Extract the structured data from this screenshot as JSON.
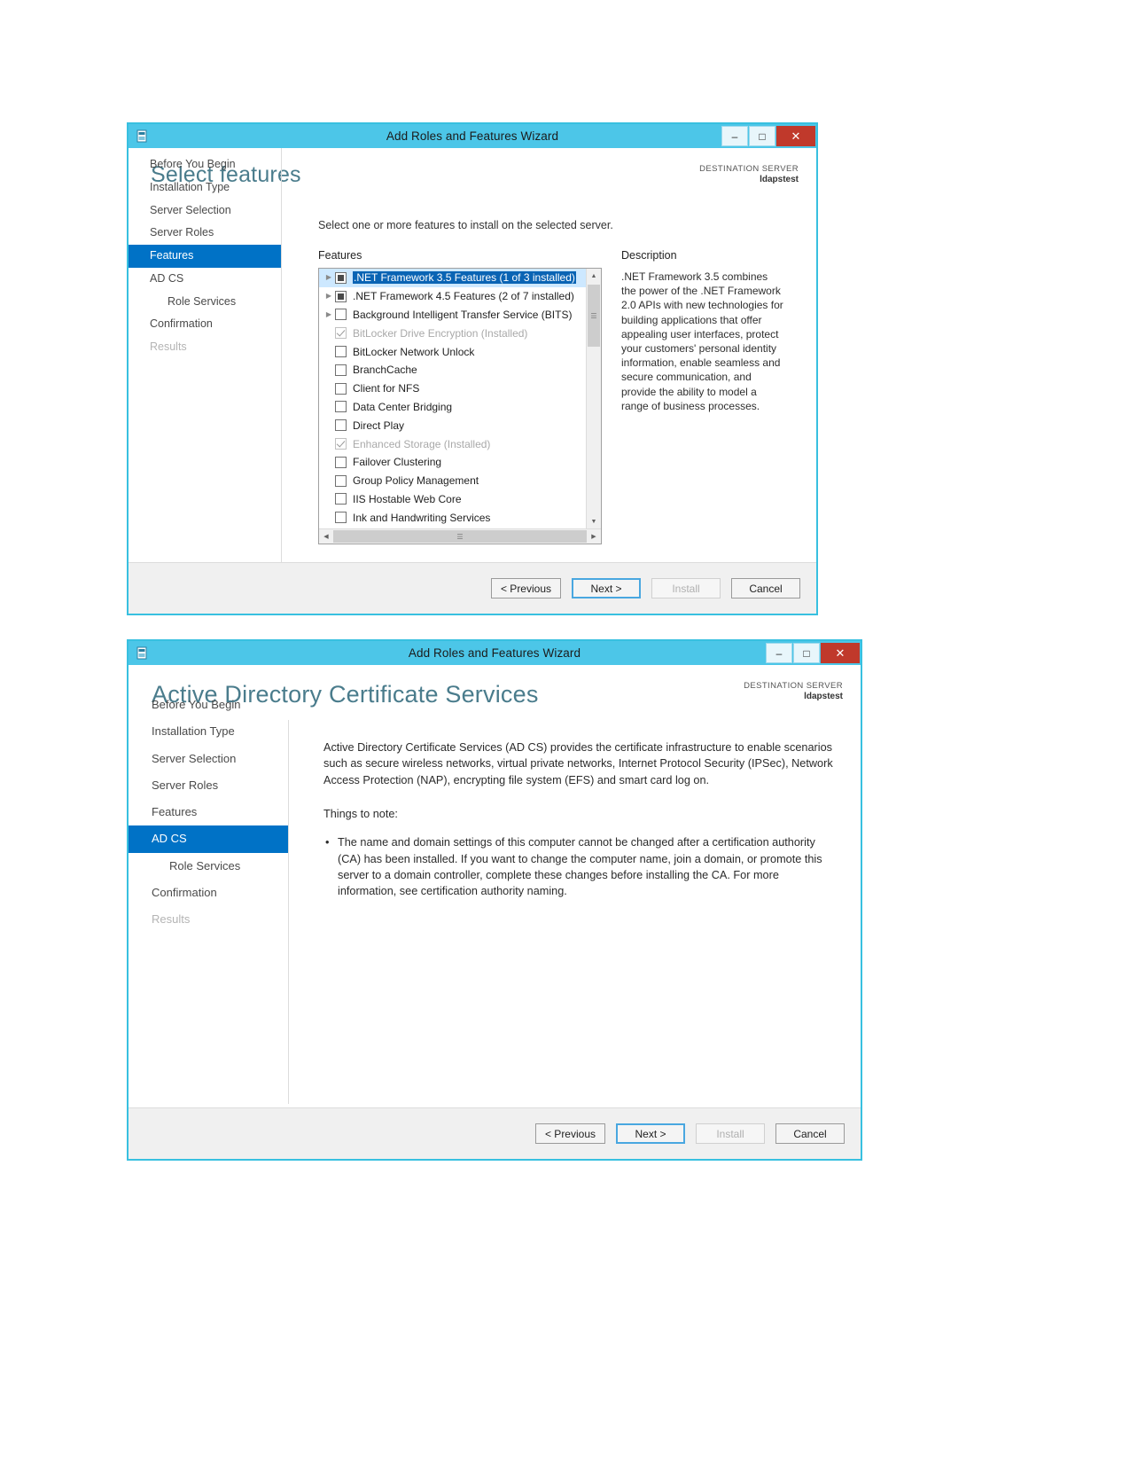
{
  "window_features": {
    "title": "Add Roles and Features Wizard",
    "icon": "server-manager-icon",
    "buttons": {
      "minimize": "–",
      "maximize": "□",
      "close": "✕"
    },
    "page_title": "Select features",
    "destination": {
      "label": "DESTINATION SERVER",
      "value": "ldapstest"
    },
    "nav": [
      {
        "label": "Before You Begin",
        "state": "normal"
      },
      {
        "label": "Installation Type",
        "state": "normal"
      },
      {
        "label": "Server Selection",
        "state": "normal"
      },
      {
        "label": "Server Roles",
        "state": "normal"
      },
      {
        "label": "Features",
        "state": "selected"
      },
      {
        "label": "AD CS",
        "state": "normal"
      },
      {
        "label": "Role Services",
        "state": "sub"
      },
      {
        "label": "Confirmation",
        "state": "normal"
      },
      {
        "label": "Results",
        "state": "disabled"
      }
    ],
    "intro": "Select one or more features to install on the selected server.",
    "features_label": "Features",
    "features": [
      {
        "label": ".NET Framework 3.5 Features (1 of 3 installed)",
        "checkbox": "partial",
        "expander": true,
        "selected": true,
        "installed": false
      },
      {
        "label": ".NET Framework 4.5 Features (2 of 7 installed)",
        "checkbox": "partial",
        "expander": true,
        "selected": false,
        "installed": false
      },
      {
        "label": "Background Intelligent Transfer Service (BITS)",
        "checkbox": "empty",
        "expander": true,
        "selected": false,
        "installed": false
      },
      {
        "label": "BitLocker Drive Encryption (Installed)",
        "checkbox": "checked-gray",
        "expander": false,
        "selected": false,
        "installed": true
      },
      {
        "label": "BitLocker Network Unlock",
        "checkbox": "empty",
        "expander": false,
        "selected": false,
        "installed": false
      },
      {
        "label": "BranchCache",
        "checkbox": "empty",
        "expander": false,
        "selected": false,
        "installed": false
      },
      {
        "label": "Client for NFS",
        "checkbox": "empty",
        "expander": false,
        "selected": false,
        "installed": false
      },
      {
        "label": "Data Center Bridging",
        "checkbox": "empty",
        "expander": false,
        "selected": false,
        "installed": false
      },
      {
        "label": "Direct Play",
        "checkbox": "empty",
        "expander": false,
        "selected": false,
        "installed": false
      },
      {
        "label": "Enhanced Storage (Installed)",
        "checkbox": "checked-gray",
        "expander": false,
        "selected": false,
        "installed": true
      },
      {
        "label": "Failover Clustering",
        "checkbox": "empty",
        "expander": false,
        "selected": false,
        "installed": false
      },
      {
        "label": "Group Policy Management",
        "checkbox": "empty",
        "expander": false,
        "selected": false,
        "installed": false
      },
      {
        "label": "IIS Hostable Web Core",
        "checkbox": "empty",
        "expander": false,
        "selected": false,
        "installed": false
      },
      {
        "label": "Ink and Handwriting Services",
        "checkbox": "empty",
        "expander": false,
        "selected": false,
        "installed": false
      }
    ],
    "description_label": "Description",
    "description": ".NET Framework 3.5 combines the power of the .NET Framework 2.0 APIs with new technologies for building applications that offer appealing user interfaces, protect your customers' personal identity information, enable seamless and secure communication, and provide the ability to model a range of business processes.",
    "footer": {
      "previous": "< Previous",
      "next": "Next >",
      "install": "Install",
      "cancel": "Cancel"
    }
  },
  "window_adcs": {
    "title": "Add Roles and Features Wizard",
    "icon": "server-manager-icon",
    "buttons": {
      "minimize": "–",
      "maximize": "□",
      "close": "✕"
    },
    "page_title": "Active Directory Certificate Services",
    "destination": {
      "label": "DESTINATION SERVER",
      "value": "ldapstest"
    },
    "nav": [
      {
        "label": "Before You Begin",
        "state": "normal"
      },
      {
        "label": "Installation Type",
        "state": "normal"
      },
      {
        "label": "Server Selection",
        "state": "normal"
      },
      {
        "label": "Server Roles",
        "state": "normal"
      },
      {
        "label": "Features",
        "state": "normal"
      },
      {
        "label": "AD CS",
        "state": "selected"
      },
      {
        "label": "Role Services",
        "state": "sub"
      },
      {
        "label": "Confirmation",
        "state": "normal"
      },
      {
        "label": "Results",
        "state": "disabled"
      }
    ],
    "intro_para": "Active Directory Certificate Services (AD CS) provides the certificate infrastructure to enable scenarios such as secure wireless networks, virtual private networks, Internet Protocol Security (IPSec), Network Access Protection (NAP), encrypting file system (EFS) and smart card log on.",
    "note_head": "Things to note:",
    "notes": [
      "The name and domain settings of this computer cannot be changed after a certification authority (CA) has been installed. If you want to change the computer name, join a domain, or promote this server to a domain controller, complete these changes before installing the CA. For more information, see certification authority naming."
    ],
    "footer": {
      "previous": "< Previous",
      "next": "Next >",
      "install": "Install",
      "cancel": "Cancel"
    }
  },
  "colors": {
    "title_bar": "#4cc6e8",
    "accent_selected": "#0072c6",
    "close_button": "#c0392b",
    "heading": "#4a7c8c"
  }
}
